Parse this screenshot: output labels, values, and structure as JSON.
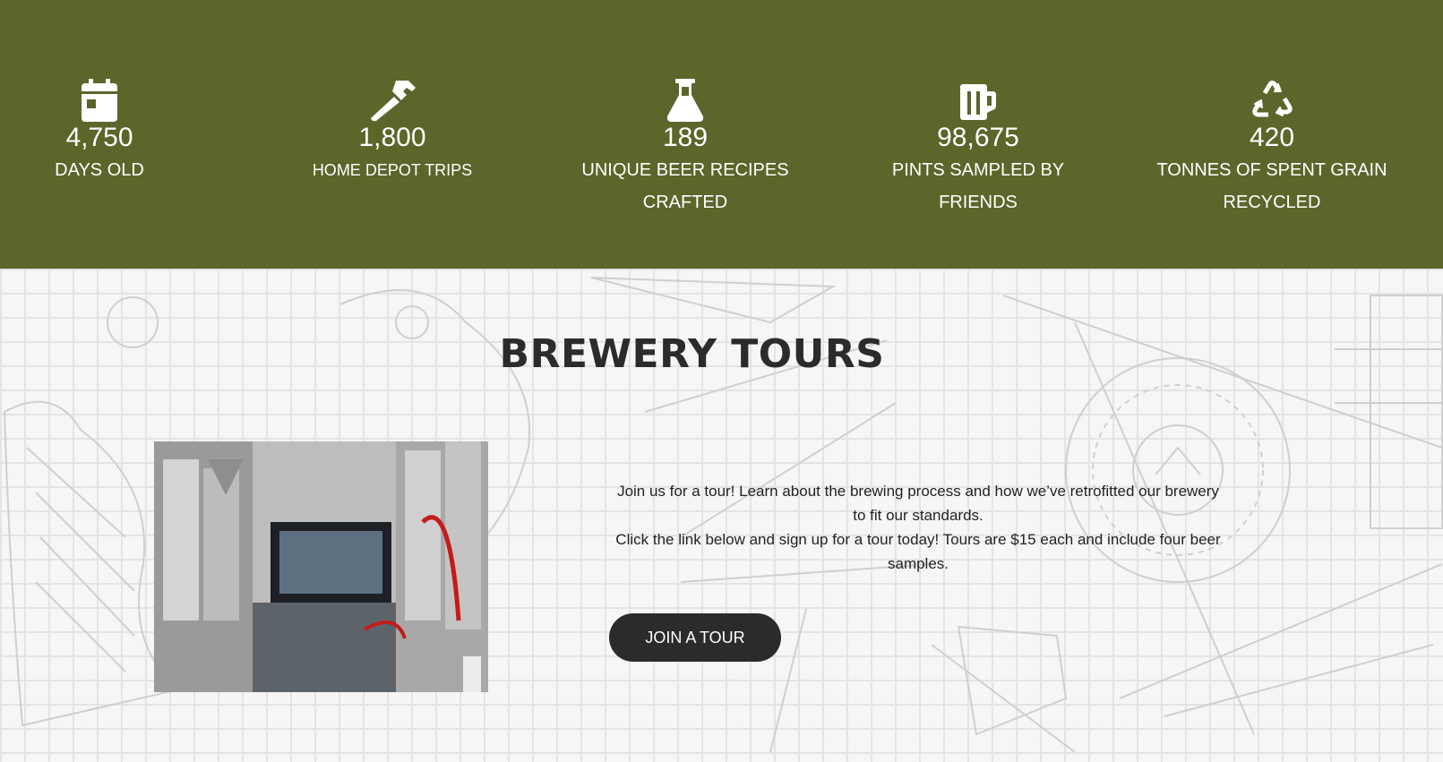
{
  "stats": [
    {
      "icon": "calendar-icon",
      "value": "4,750",
      "label": "DAYS OLD"
    },
    {
      "icon": "hammer-icon",
      "value": "1,800",
      "label": "HOME DEPOT TRIPS"
    },
    {
      "icon": "flask-icon",
      "value": "189",
      "label": "UNIQUE BEER RECIPES CRAFTED"
    },
    {
      "icon": "beer-mug-icon",
      "value": "98,675",
      "label": "PINTS SAMPLED BY FRIENDS"
    },
    {
      "icon": "recycle-icon",
      "value": "420",
      "label": "TONNES OF SPENT GRAIN RECYCLED"
    }
  ],
  "tours": {
    "title": "BREWERY TOURS",
    "paragraph1": "Join us for a tour! Learn about the brewing process and how we’ve retrofitted our brewery to fit our standards.",
    "paragraph2": "Click the link below and sign up for a tour today! Tours are $15 each and include four beer samples.",
    "button_label": "JOIN A TOUR"
  },
  "colors": {
    "stats_band": "#5c652a",
    "button": "#2b2b2b"
  }
}
